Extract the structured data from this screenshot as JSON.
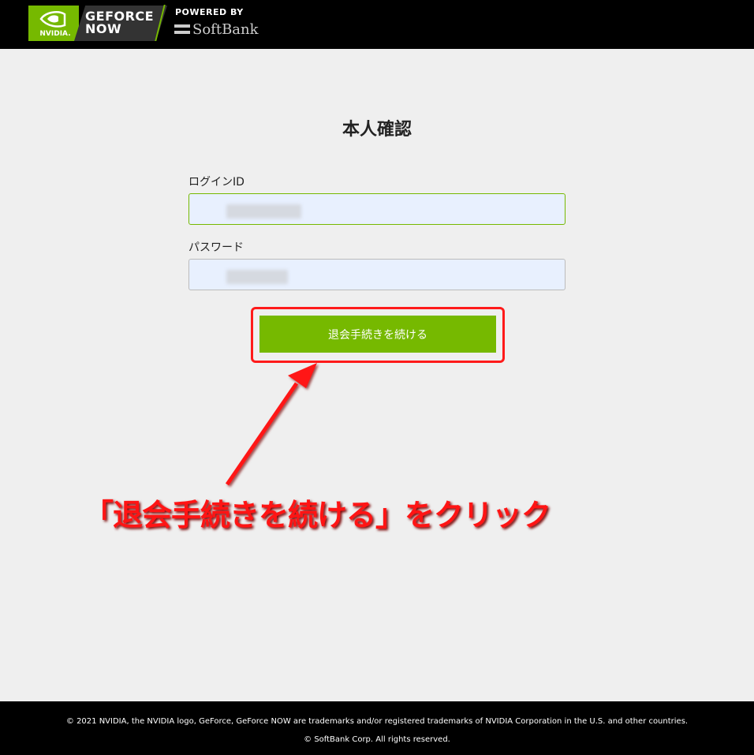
{
  "header": {
    "nvidia_label": "NVIDIA.",
    "geforce_line1": "GEFORCE",
    "geforce_line2": "NOW",
    "powered_by": "POWERED BY",
    "softbank": "SoftBank"
  },
  "form": {
    "title": "本人確認",
    "login_label": "ログインID",
    "password_label": "パスワード",
    "submit_label": "退会手続きを続ける"
  },
  "annotation": {
    "callout": "「退会手続きを続ける」をクリック",
    "color": "#ff1414"
  },
  "footer": {
    "line1": "© 2021 NVIDIA, the NVIDIA logo, GeForce, GeForce NOW are trademarks and/or registered trademarks of NVIDIA Corporation in the U.S. and other countries.",
    "line2": "© SoftBank Corp. All rights reserved."
  },
  "colors": {
    "accent": "#76b900",
    "header_bg": "#000000",
    "page_bg": "#efefef",
    "input_bg": "#e8f0fe"
  }
}
